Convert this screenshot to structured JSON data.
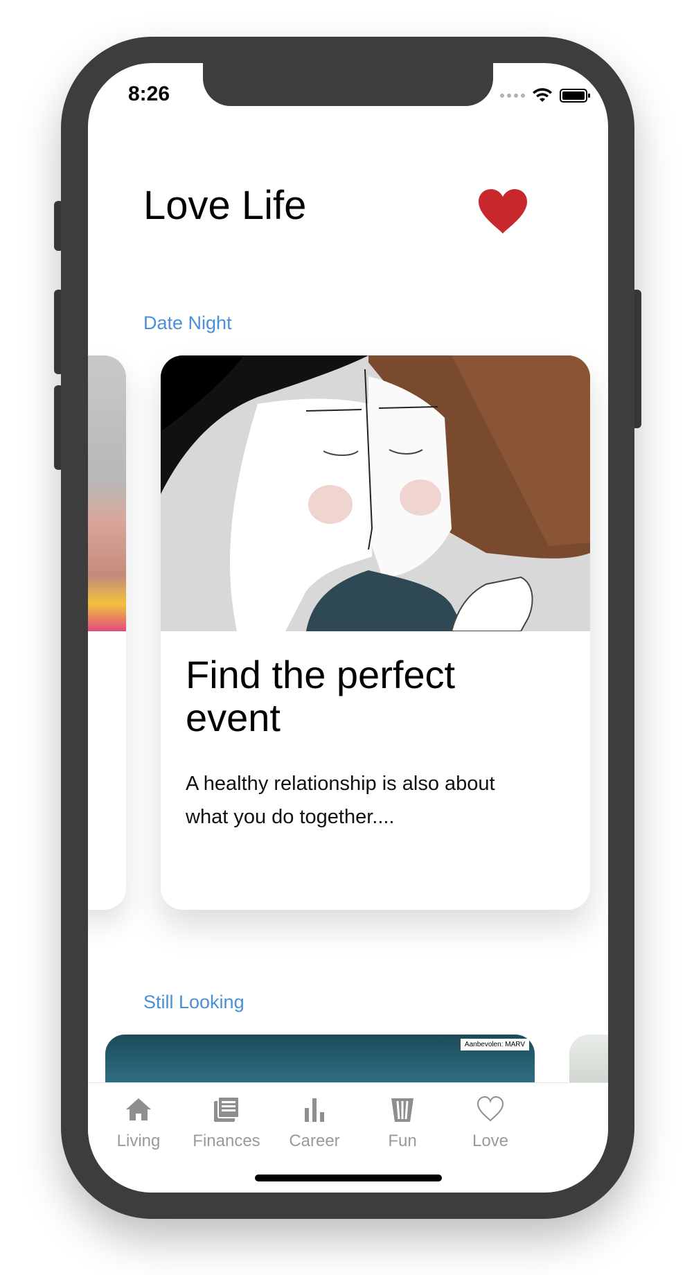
{
  "status_bar": {
    "time": "8:26"
  },
  "header": {
    "title": "Love Life"
  },
  "sections": [
    {
      "label": "Date Night"
    },
    {
      "label": "Still Looking"
    }
  ],
  "featured_card": {
    "title": "Find the perfect event",
    "body": "A healthy relationship is also about what you do together...."
  },
  "second_card": {
    "badge": "Aanbevolen: MARV"
  },
  "tabbar": {
    "items": [
      {
        "label": "Living",
        "icon": "home-icon"
      },
      {
        "label": "Finances",
        "icon": "newspaper-icon"
      },
      {
        "label": "Career",
        "icon": "bar-chart-icon"
      },
      {
        "label": "Fun",
        "icon": "popcorn-icon"
      },
      {
        "label": "Love",
        "icon": "heart-outline-icon"
      }
    ]
  },
  "colors": {
    "accent": "#4a90d9",
    "heart": "#c8272c",
    "tab_inactive": "#9a9a9a",
    "frame": "#3d3d3d"
  }
}
